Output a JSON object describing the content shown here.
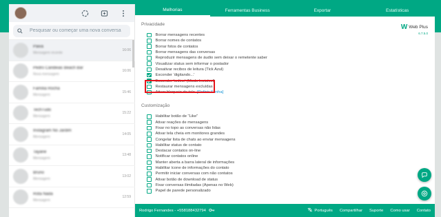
{
  "sidebar": {
    "search_placeholder": "Pesquisar ou começar uma nova conversa",
    "chats": [
      {
        "name": "Paiva",
        "msg": "Mensagem recente",
        "time": "16:06",
        "active": true
      },
      {
        "name": "Pedro Candeias Beach Bar",
        "msg": "Nova mensagem",
        "time": "16:06",
        "active": false
      },
      {
        "name": "Família Rocha",
        "msg": "Mensagem",
        "time": "15:46",
        "active": false
      },
      {
        "name": "TechTudo",
        "msg": "Mensagem",
        "time": "15:22",
        "active": false
      },
      {
        "name": "Instagram No Jardim",
        "msg": "Mensagem",
        "time": "14:05",
        "active": false
      },
      {
        "name": "Tayane",
        "msg": "Mensagem",
        "time": "13:48",
        "active": false
      },
      {
        "name": "Bruno",
        "msg": "Mensagem",
        "time": "13:02",
        "active": false
      },
      {
        "name": "Rota Nada",
        "msg": "Mensagem",
        "time": "12:59",
        "active": false
      }
    ]
  },
  "tabs": [
    "Melhorias",
    "Ferramentas Business",
    "Exportar",
    "Estatísticas"
  ],
  "logo": {
    "text": "Web Plus",
    "version": "6.7.5.0"
  },
  "privacy": {
    "title": "Privacidade",
    "options": [
      {
        "label": "Borrar mensagens recentes",
        "checked": false
      },
      {
        "label": "Borrar nomes de contatos",
        "checked": false
      },
      {
        "label": "Borrar fotos de contatos",
        "checked": false
      },
      {
        "label": "Borrar mensagens das conversas",
        "checked": false
      },
      {
        "label": "Reproduzir mensagens de áudio sem deixar o remetente saber",
        "checked": false
      },
      {
        "label": "Visualizar status sem informar o postador",
        "checked": false
      },
      {
        "label": "Desativar recibos de leitura (Tick Azul)",
        "checked": false
      },
      {
        "label": "Esconder 'digitando...'",
        "checked": true
      },
      {
        "label": "Esconder 'online' (Modo Invisível)",
        "checked": true
      },
      {
        "label": "Restaurar mensagens excluídas",
        "checked": false
      },
      {
        "label": "Ativar bloqueio de tela",
        "checked": false,
        "link": "[Definir Senha]"
      }
    ]
  },
  "custom": {
    "title": "Customização",
    "options": [
      {
        "label": "Habilitar botão de \"Like\"",
        "checked": false
      },
      {
        "label": "Ativar reações de mensagens",
        "checked": false
      },
      {
        "label": "Fixar no topo as conversas não lidas",
        "checked": false
      },
      {
        "label": "Ativar tela cheia em monitores grandes",
        "checked": false
      },
      {
        "label": "Congelar lista de chats ao enviar mensagens",
        "checked": false
      },
      {
        "label": "Habilitar status de contato",
        "checked": false
      },
      {
        "label": "Destacar contatos on-line",
        "checked": false
      },
      {
        "label": "Notificar contatos online",
        "checked": false
      },
      {
        "label": "Manter aberta a barra lateral de informações",
        "checked": false
      },
      {
        "label": "Habilitar ícone de informações do contato",
        "checked": false
      },
      {
        "label": "Permitir iniciar conversas com não contatos",
        "checked": false
      },
      {
        "label": "Ativar botão de download de status",
        "checked": false
      },
      {
        "label": "Fixar conversas ilimitadas (Apenas no Web)",
        "checked": false
      },
      {
        "label": "Papel de parede personalizado",
        "checked": false
      }
    ]
  },
  "footer": {
    "user": "Rodrigo Fernandes - +558188432794",
    "language": "Português",
    "share": "Compartilhar",
    "support": "Suporte",
    "howto": "Como usar",
    "contact": "Contato"
  }
}
